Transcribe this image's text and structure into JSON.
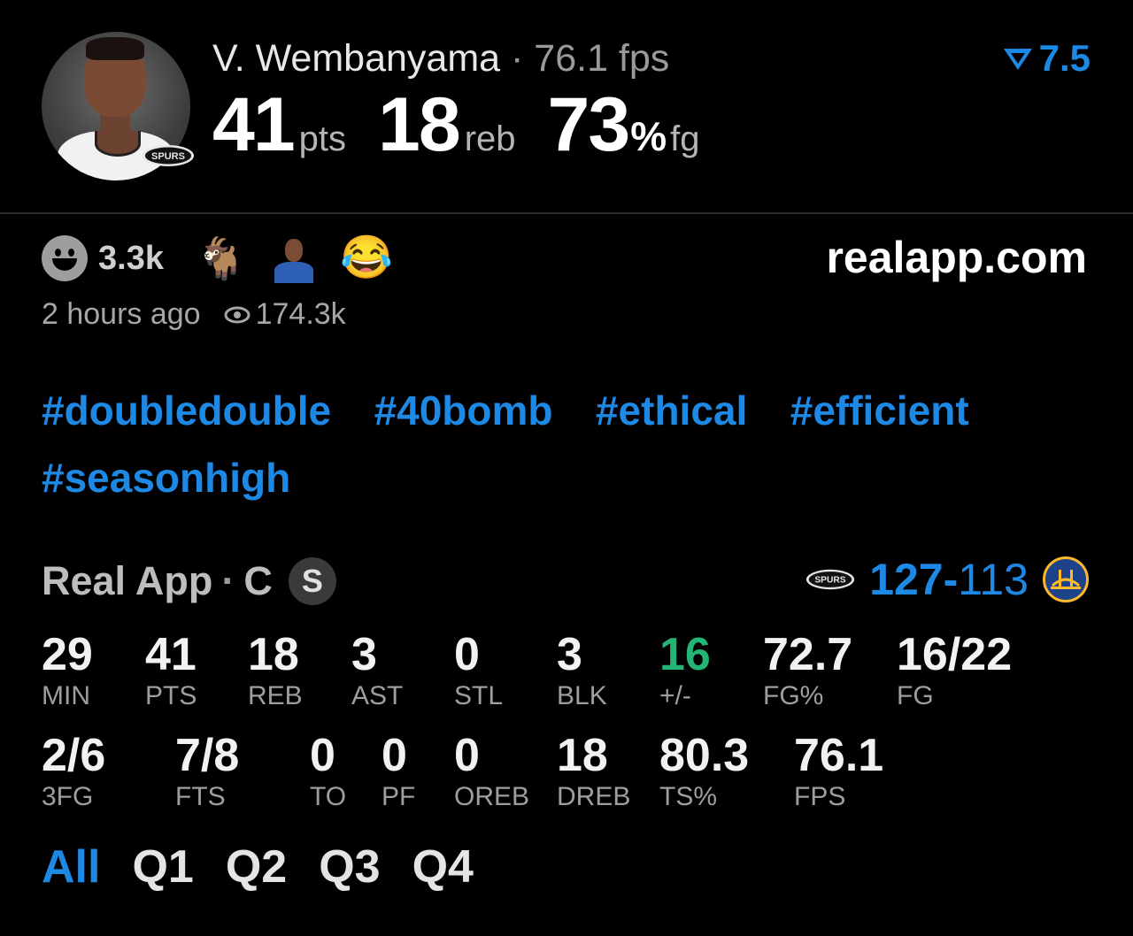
{
  "header": {
    "player_name": "V. Wembanyama",
    "separator": "·",
    "fps": "76.1 fps",
    "rating": "7.5",
    "big_stats": {
      "pts_value": "41",
      "pts_unit": "pts",
      "reb_value": "18",
      "reb_unit": "reb",
      "fg_value": "73",
      "fg_pct": "%",
      "fg_unit": "fg"
    },
    "team_logo_text": "SPURS"
  },
  "reactions": {
    "count": "3.3k",
    "goat": "🐐",
    "laugh": "😂"
  },
  "site": "realapp.com",
  "meta": {
    "time_ago": "2 hours ago",
    "views": "174.3k"
  },
  "hashtags": [
    "#doubledouble",
    "#40bomb",
    "#ethical",
    "#efficient",
    "#seasonhigh"
  ],
  "game": {
    "label": "Real App",
    "separator": "·",
    "position": "C",
    "badge": "S",
    "score_team": "127",
    "score_dash": "-",
    "score_opp": "113",
    "home_logo_text": "SPURS"
  },
  "stats_row1": [
    {
      "value": "29",
      "label": "MIN"
    },
    {
      "value": "41",
      "label": "PTS"
    },
    {
      "value": "18",
      "label": "REB"
    },
    {
      "value": "3",
      "label": "AST"
    },
    {
      "value": "0",
      "label": "STL"
    },
    {
      "value": "3",
      "label": "BLK"
    },
    {
      "value": "16",
      "label": "+/-"
    },
    {
      "value": "72.7",
      "label": "FG%"
    },
    {
      "value": "16/22",
      "label": "FG"
    }
  ],
  "stats_row2": [
    {
      "value": "2/6",
      "label": "3FG"
    },
    {
      "value": "7/8",
      "label": "FTS"
    },
    {
      "value": "0",
      "label": "TO"
    },
    {
      "value": "0",
      "label": "PF"
    },
    {
      "value": "0",
      "label": "OREB"
    },
    {
      "value": "18",
      "label": "DREB"
    },
    {
      "value": "80.3",
      "label": "TS%"
    },
    {
      "value": "76.1",
      "label": "FPS"
    }
  ],
  "quarter_tabs": [
    "All",
    "Q1",
    "Q2",
    "Q3",
    "Q4"
  ],
  "colors": {
    "accent": "#1e88e5",
    "positive": "#22b573",
    "background": "#000000"
  }
}
